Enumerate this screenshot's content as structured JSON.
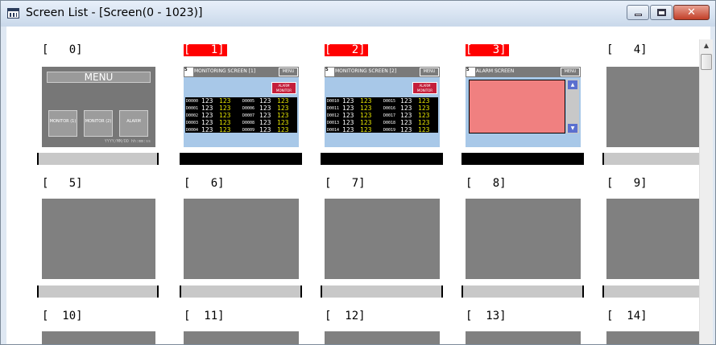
{
  "window": {
    "title": "Screen List - [Screen(0 - 1023)]",
    "buttons": {
      "minimize_icon": "minimize-icon",
      "maximize_icon": "maximize-icon",
      "close_icon": "close-icon",
      "close_glyph": "✕"
    }
  },
  "screens": [
    {
      "id": 0,
      "label": "[   0]",
      "active": false
    },
    {
      "id": 1,
      "label": "[   1]",
      "active": true
    },
    {
      "id": 2,
      "label": "[   2]",
      "active": true
    },
    {
      "id": 3,
      "label": "[   3]",
      "active": true
    },
    {
      "id": 4,
      "label": "[   4]",
      "active": false
    },
    {
      "id": 5,
      "label": "[   5]",
      "active": false
    },
    {
      "id": 6,
      "label": "[   6]",
      "active": false
    },
    {
      "id": 7,
      "label": "[   7]",
      "active": false
    },
    {
      "id": 8,
      "label": "[   8]",
      "active": false
    },
    {
      "id": 9,
      "label": "[   9]",
      "active": false
    },
    {
      "id": 10,
      "label": "[  10]",
      "active": false
    },
    {
      "id": 11,
      "label": "[  11]",
      "active": false
    },
    {
      "id": 12,
      "label": "[  12]",
      "active": false
    },
    {
      "id": 13,
      "label": "[  13]",
      "active": false
    },
    {
      "id": 14,
      "label": "[  14]",
      "active": false
    }
  ],
  "thumb_menu": {
    "title": "MENU",
    "buttons": [
      "MONITOR (1)",
      "MONITOR (2)",
      "ALARM"
    ],
    "date": "YYYY/MM/DD hh:mm:ss"
  },
  "thumb_monitor1": {
    "header": "MONITORING SCREEN [1]",
    "menu": "MENU",
    "alarm_button": "ALARM MONITOR",
    "rows": [
      [
        "D0000",
        "D0005"
      ],
      [
        "D0001",
        "D0006"
      ],
      [
        "D0002",
        "D0007"
      ],
      [
        "D0003",
        "D0008"
      ],
      [
        "D0004",
        "D0009"
      ]
    ],
    "value": "123"
  },
  "thumb_monitor2": {
    "header": "MONITORING SCREEN [2]",
    "menu": "MENU",
    "alarm_button": "ALARM MONITOR",
    "rows": [
      [
        "D0010",
        "D0015"
      ],
      [
        "D0011",
        "D0016"
      ],
      [
        "D0012",
        "D0017"
      ],
      [
        "D0013",
        "D0018"
      ],
      [
        "D0014",
        "D0019"
      ]
    ],
    "value": "123"
  },
  "thumb_alarm": {
    "header": "ALARM SCREEN",
    "menu": "MENU",
    "scroll_up": "▲",
    "scroll_down": "▼"
  },
  "scrollbar": {
    "up_arrow": "▲"
  }
}
